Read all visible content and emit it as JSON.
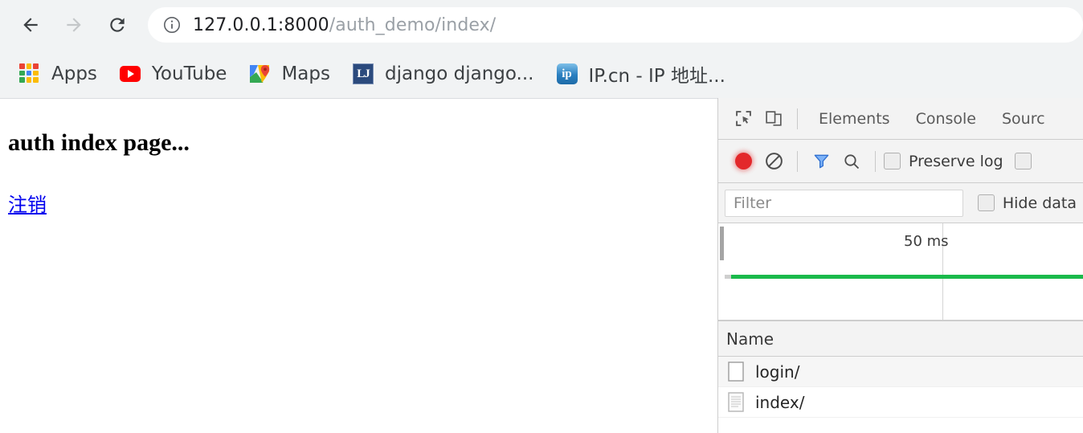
{
  "browser": {
    "nav": {
      "back_label": "Back",
      "forward_label": "Forward",
      "reload_label": "Reload"
    },
    "omnibox": {
      "info_icon": "info-circle-icon",
      "url_host": "127.0.0.1:8000",
      "url_path": "/auth_demo/index/",
      "full_url": "127.0.0.1:8000/auth_demo/index/"
    },
    "bookmarks": [
      {
        "label": "Apps",
        "icon": "apps-grid-icon"
      },
      {
        "label": "YouTube",
        "icon": "youtube-icon"
      },
      {
        "label": "Maps",
        "icon": "google-maps-icon"
      },
      {
        "label": "django django...",
        "icon": "django-lj-icon"
      },
      {
        "label": "IP.cn - IP 地址...",
        "icon": "ipcn-icon"
      }
    ]
  },
  "page": {
    "heading": "auth index page...",
    "logout_link": "注销"
  },
  "devtools": {
    "toolbar_icons": {
      "inspect": "inspect-element-icon",
      "device": "device-toolbar-icon"
    },
    "tabs": [
      {
        "label": "Elements",
        "active": false
      },
      {
        "label": "Console",
        "active": false
      },
      {
        "label": "Sourc",
        "active": false
      }
    ],
    "network_toolbar": {
      "record_label": "Record",
      "clear_label": "Clear",
      "filter_label": "Filter",
      "search_label": "Search",
      "preserve_log_label": "Preserve log",
      "preserve_log_checked": false,
      "disable_cache_checked": false
    },
    "filter_bar": {
      "filter_placeholder": "Filter",
      "filter_value": "",
      "hide_data_label": "Hide data",
      "hide_data_checked": false
    },
    "overview": {
      "time_marker": "50 ms"
    },
    "table": {
      "columns": [
        "Name"
      ],
      "rows": [
        {
          "name": "login/",
          "icon": "blank-document-icon"
        },
        {
          "name": "index/",
          "icon": "lined-document-icon"
        }
      ]
    }
  },
  "colors": {
    "toolbar_bg": "#f1f3f4",
    "record_red": "#e3282b",
    "filter_blue": "#4d8ff5",
    "timeline_green": "#1aba4b",
    "link_blue": "#0000ee"
  }
}
